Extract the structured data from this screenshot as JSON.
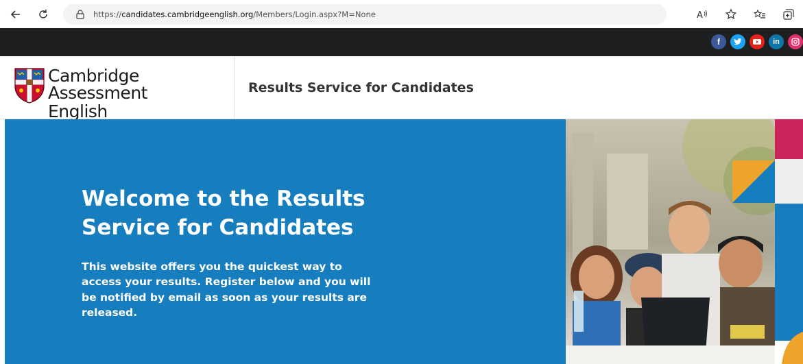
{
  "browser": {
    "url_prefix": "https://",
    "url_host": "candidates.cambridgeenglish.org",
    "url_path": "/Members/Login.aspx?M=None",
    "actions": [
      "read-aloud-icon",
      "favorite-icon",
      "favorites-list-icon",
      "collections-icon"
    ]
  },
  "social": {
    "icons": [
      "facebook-icon",
      "twitter-icon",
      "youtube-icon",
      "linkedin-icon",
      "instagram-icon"
    ]
  },
  "header": {
    "logo_line1": "Cambridge Assessment",
    "logo_line2": "English",
    "service_title": "Results Service for Candidates"
  },
  "hero": {
    "title": "Welcome to the Results Service for Candidates",
    "text": "This website offers you the quickest way to access your results. Register below and you will be notified by email as soon as your results are released."
  },
  "colors": {
    "hero_blue": "#167ebf",
    "dark_bar": "#1e1f21",
    "accent_pink": "#c9245b",
    "accent_orange": "#eea32a"
  }
}
